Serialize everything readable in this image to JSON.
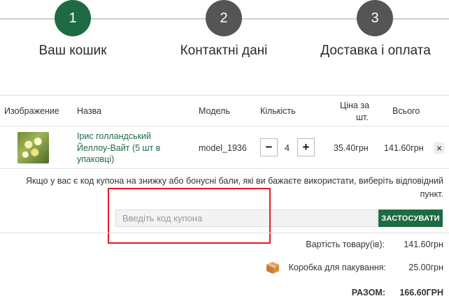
{
  "steps": [
    {
      "number": "1",
      "label": "Ваш кошик",
      "color": "#1e6b43"
    },
    {
      "number": "2",
      "label": "Контактні дані",
      "color": "#555555"
    },
    {
      "number": "3",
      "label": "Доставка і оплата",
      "color": "#555555"
    }
  ],
  "table": {
    "headers": {
      "image": "Изображение",
      "name": "Назва",
      "model": "Модель",
      "qty": "Кількість",
      "price_line1": "Ціна за",
      "price_line2": "шт.",
      "total": "Всього"
    },
    "row": {
      "name": "Ірис голландський Йеллоу-Вайт (5 шт в упаковці)",
      "model": "model_1936",
      "qty": "4",
      "minus": "−",
      "plus": "+",
      "price": "35.40грн",
      "total": "141.60грн",
      "remove": "×"
    }
  },
  "coupon": {
    "description": "Якщо у вас є код купона на знижку або бонусні бали, які ви бажаєте використати, виберіть відповідний пункт.",
    "placeholder": "Введіть код купона",
    "apply_label": "ЗАСТОСУВАТИ"
  },
  "totals": {
    "subtotal_label": "Вартість товару(ів):",
    "subtotal_value": "141.60грн",
    "packaging_label": "Коробка для пакування:",
    "packaging_value": "25.00грн",
    "total_label": "РАЗОМ:",
    "total_value": "166.60ГРН"
  },
  "colors": {
    "accent": "#1e6b43",
    "highlight": "#e31b23"
  }
}
